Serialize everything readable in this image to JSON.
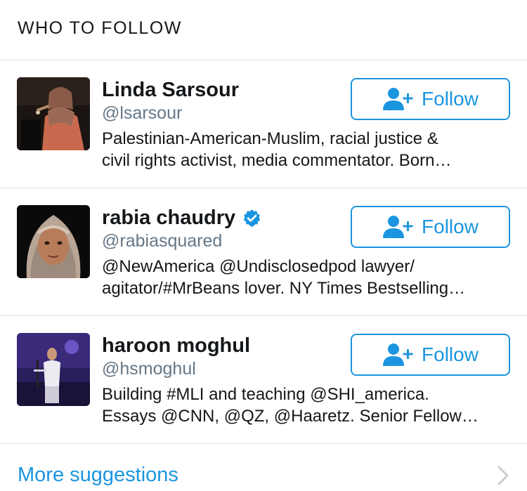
{
  "section_title": "WHO TO FOLLOW",
  "colors": {
    "accent": "#1b95e0",
    "secondary_text": "#657786",
    "divider": "#dfe2e5"
  },
  "suggestions": [
    {
      "name": "Linda Sarsour",
      "handle": "@lsarsour",
      "verified": false,
      "bio_line_1": "Palestinian-American-Muslim, racial justice &",
      "bio_line_2": "civil rights activist, media commentator. Born…",
      "follow_label": "Follow",
      "follow_icon": "add-user-icon"
    },
    {
      "name": "rabia chaudry",
      "handle": "@rabiasquared",
      "verified": true,
      "bio_line_1": "@NewAmerica @Undisclosedpod lawyer/",
      "bio_line_2": "agitator/#MrBeans lover. NY Times Bestselling…",
      "follow_label": "Follow",
      "follow_icon": "add-user-icon"
    },
    {
      "name": "haroon moghul",
      "handle": "@hsmoghul",
      "verified": false,
      "bio_line_1": "Building #MLI and teaching @SHI_america.",
      "bio_line_2": "Essays @CNN, @QZ, @Haaretz. Senior Fellow…",
      "follow_label": "Follow",
      "follow_icon": "add-user-icon"
    }
  ],
  "more_suggestions": {
    "label": "More suggestions",
    "icon": "chevron-right-icon"
  }
}
